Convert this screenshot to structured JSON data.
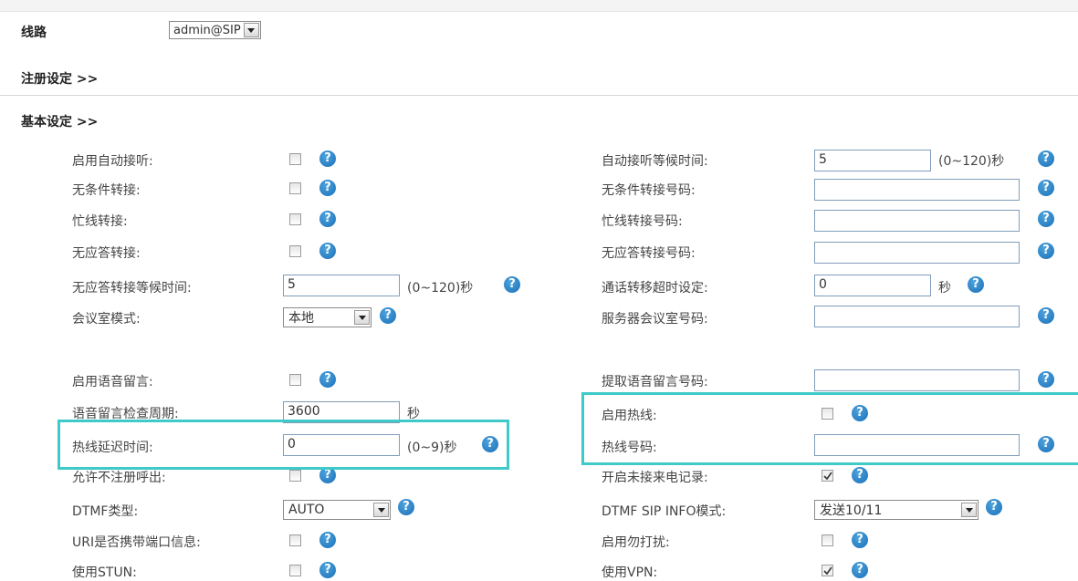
{
  "line": {
    "label": "线路",
    "value": "admin@SIP"
  },
  "sections": {
    "register": "注册设定 >>",
    "basic": "基本设定 >>"
  },
  "help_glyph": "?",
  "rows": {
    "r1": {
      "left_label": "启用自动接听:",
      "right_label": "自动接听等候时间:",
      "right_value": "5",
      "right_unit": "(0~120)秒"
    },
    "r2": {
      "left_label": "无条件转接:",
      "right_label": "无条件转接号码:",
      "right_value": ""
    },
    "r3": {
      "left_label": "忙线转接:",
      "right_label": "忙线转接号码:",
      "right_value": ""
    },
    "r4": {
      "left_label": "无应答转接:",
      "right_label": "无应答转接号码:",
      "right_value": ""
    },
    "r5": {
      "left_label": "无应答转接等候时间:",
      "left_value": "5",
      "left_unit": "(0~120)秒",
      "right_label": "通话转移超时设定:",
      "right_value": "0",
      "right_unit": "秒"
    },
    "r6": {
      "left_label": "会议室模式:",
      "left_select": "本地",
      "right_label": "服务器会议室号码:",
      "right_value": ""
    },
    "r7": {
      "left_label": "启用语音留言:",
      "right_label": "提取语音留言号码:",
      "right_value": ""
    },
    "r8": {
      "left_label": "语音留言检查周期:",
      "left_value": "3600",
      "left_unit": "秒",
      "right_label": "启用热线:"
    },
    "r9": {
      "left_label": "热线延迟时间:",
      "left_value": "0",
      "left_unit": "(0~9)秒",
      "right_label": "热线号码:",
      "right_value": ""
    },
    "r10": {
      "left_label": "允许不注册呼出:",
      "right_label": "开启未接来电记录:"
    },
    "r11": {
      "left_label": "DTMF类型:",
      "left_select": "AUTO",
      "right_label": "DTMF SIP INFO模式:",
      "right_select": "发送10/11"
    },
    "r12": {
      "left_label": "URI是否携带端口信息:",
      "right_label": "启用勿打扰:"
    },
    "r13": {
      "left_label": "使用STUN:",
      "right_label": "使用VPN:"
    }
  },
  "checkboxes": {
    "auto_answer": false,
    "unconditional_forward": false,
    "busy_forward": false,
    "no_answer_forward": false,
    "voicemail": false,
    "hotline": false,
    "call_without_register": false,
    "missed_call_log": true,
    "uri_port": false,
    "dnd": false,
    "stun": false,
    "vpn": true
  },
  "colors": {
    "highlight": "#3fc9c9",
    "help_icon": "#1a6fb8"
  }
}
